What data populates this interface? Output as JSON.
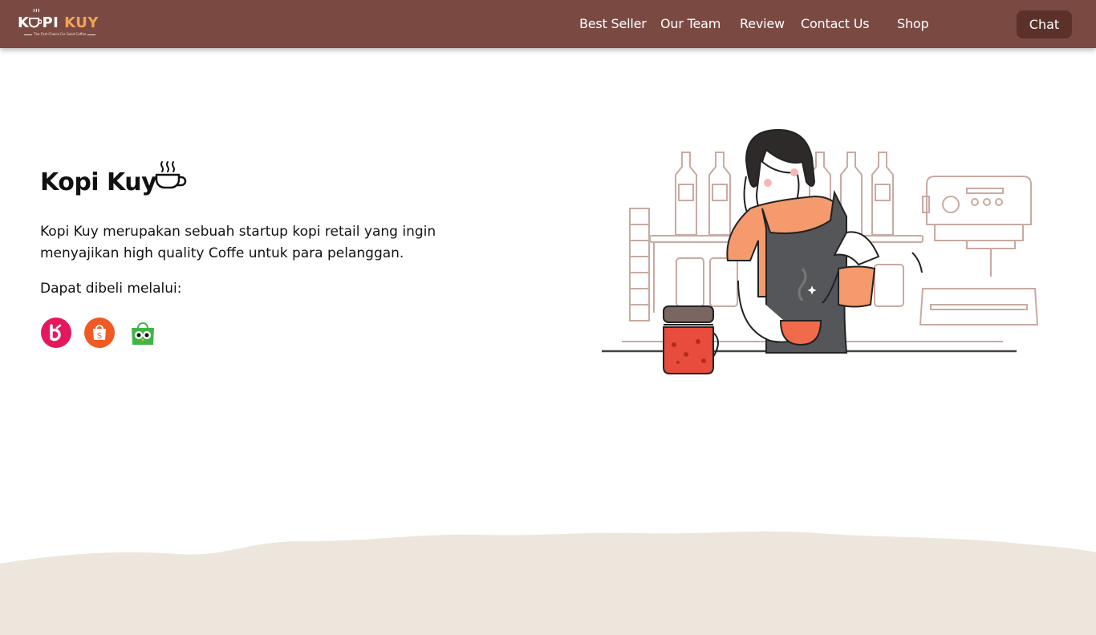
{
  "brand": {
    "logo_prefix": "K",
    "logo_mid": "PI",
    "logo_accent": "KUY",
    "tagline": "The First Choice For Good Coffee",
    "color_primary": "#7a4a42",
    "color_accent": "#f2a35a",
    "color_dark": "#5b312a"
  },
  "nav": {
    "links": [
      {
        "label": "Best Seller"
      },
      {
        "label": "Our Team"
      },
      {
        "label": "Review"
      },
      {
        "label": "Contact Us"
      },
      {
        "label": "Shop"
      }
    ],
    "chat_label": "Chat"
  },
  "hero": {
    "title": "Kopi Kuy",
    "title_icon": "hot-coffee-cup-icon",
    "description": "Kopi Kuy merupakan sebuah startup kopi retail yang ingin menyajikan high quality Coffe untuk para pelanggan.",
    "buy_label": "Dapat dibeli melalui:",
    "marketplaces": [
      {
        "icon": "blibli-icon",
        "color": "#e5185d"
      },
      {
        "icon": "shopee-icon",
        "color": "#f05a24"
      },
      {
        "icon": "tokopedia-icon",
        "color": "#42b549"
      }
    ],
    "illustration": "barista-pouring-coffee-illustration"
  },
  "footer_wave_color": "#ede6dc"
}
